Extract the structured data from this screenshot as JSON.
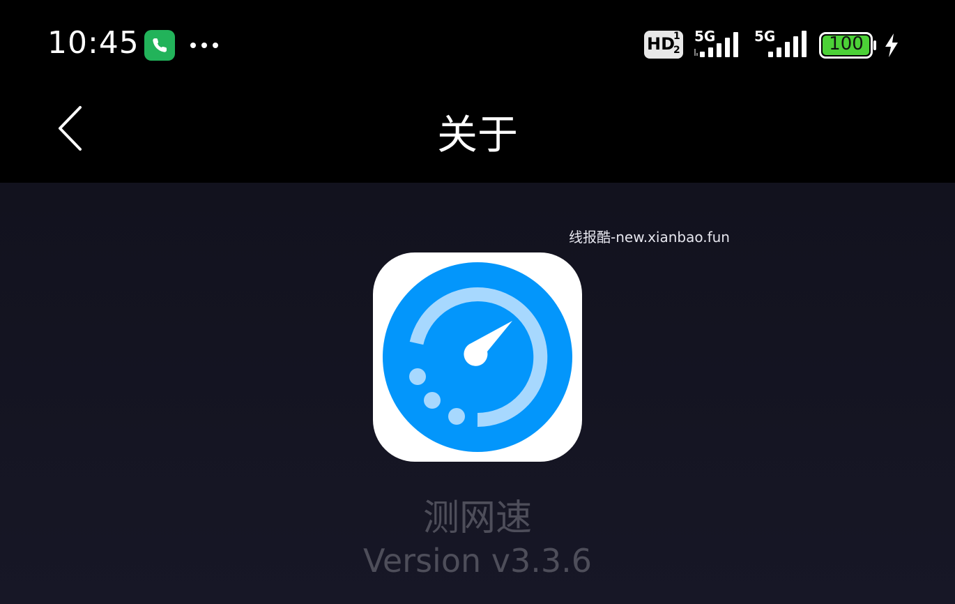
{
  "status_bar": {
    "time": "10:45",
    "hd_label": "HD",
    "hd_sup": "1",
    "hd_sub": "2",
    "network_1": "5G",
    "network_2": "5G",
    "battery": "100",
    "icons": [
      "phone-call-icon",
      "more-dots-icon",
      "hd-voice-icon",
      "signal-icon",
      "signal-icon",
      "battery-icon",
      "charging-bolt-icon"
    ],
    "colors": {
      "call_badge": "#22b35a",
      "battery_fill": "#4cd137"
    }
  },
  "navbar": {
    "title": "关于",
    "back_icon": "chevron-left-icon"
  },
  "content": {
    "watermark": "线报酷-new.xianbao.fun",
    "app_name": "测网速",
    "version": "Version v3.3.6",
    "app_icon": "speedometer-icon",
    "colors": {
      "icon_blue": "#0396fb",
      "icon_light_blue": "#a7d8fe"
    }
  }
}
